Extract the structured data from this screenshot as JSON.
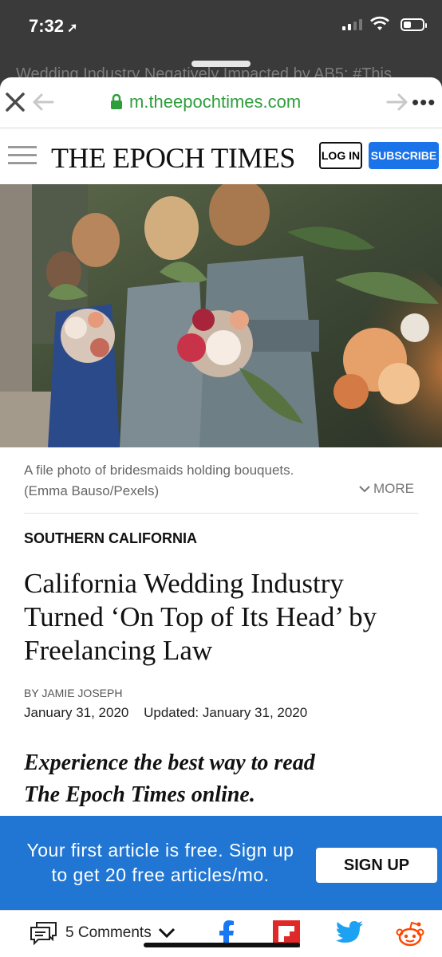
{
  "status_bar": {
    "time": "7:32"
  },
  "background_tab": {
    "title": "Wedding Industry Negatively Impacted by AB5: #This"
  },
  "browser": {
    "url": "m.theepochtimes.com"
  },
  "masthead": {
    "logo": "THE EPOCH TIMES",
    "login_label": "LOG IN",
    "subscribe_label": "SUBSCRIBE"
  },
  "photo": {
    "caption_line1": "A file photo of bridesmaids holding bouquets.",
    "caption_line2": "(Emma Bauso/Pexels)",
    "more_label": "MORE"
  },
  "article": {
    "section": "SOUTHERN CALIFORNIA",
    "headline": "California Wedding Industry Turned ‘On Top of Its Head’ by Freelancing Law",
    "byline": "BY JAMIE JOSEPH",
    "published": "January 31, 2020",
    "updated": "Updated: January 31, 2020"
  },
  "promo": {
    "line1": "Experience the best way to read",
    "line2": "The Epoch Times online."
  },
  "banner": {
    "line1": "Your first article is free. Sign up",
    "line2": "to get 20 free articles/mo.",
    "signup_label": "SIGN UP"
  },
  "toolbar": {
    "comments_label": "5 Comments"
  },
  "colors": {
    "accent_blue": "#2076d2",
    "url_green": "#2e9e3c",
    "flipboard_red": "#e12828",
    "twitter_blue": "#1da1f2",
    "reddit_orange": "#ff4500",
    "facebook_blue": "#1877f2"
  }
}
